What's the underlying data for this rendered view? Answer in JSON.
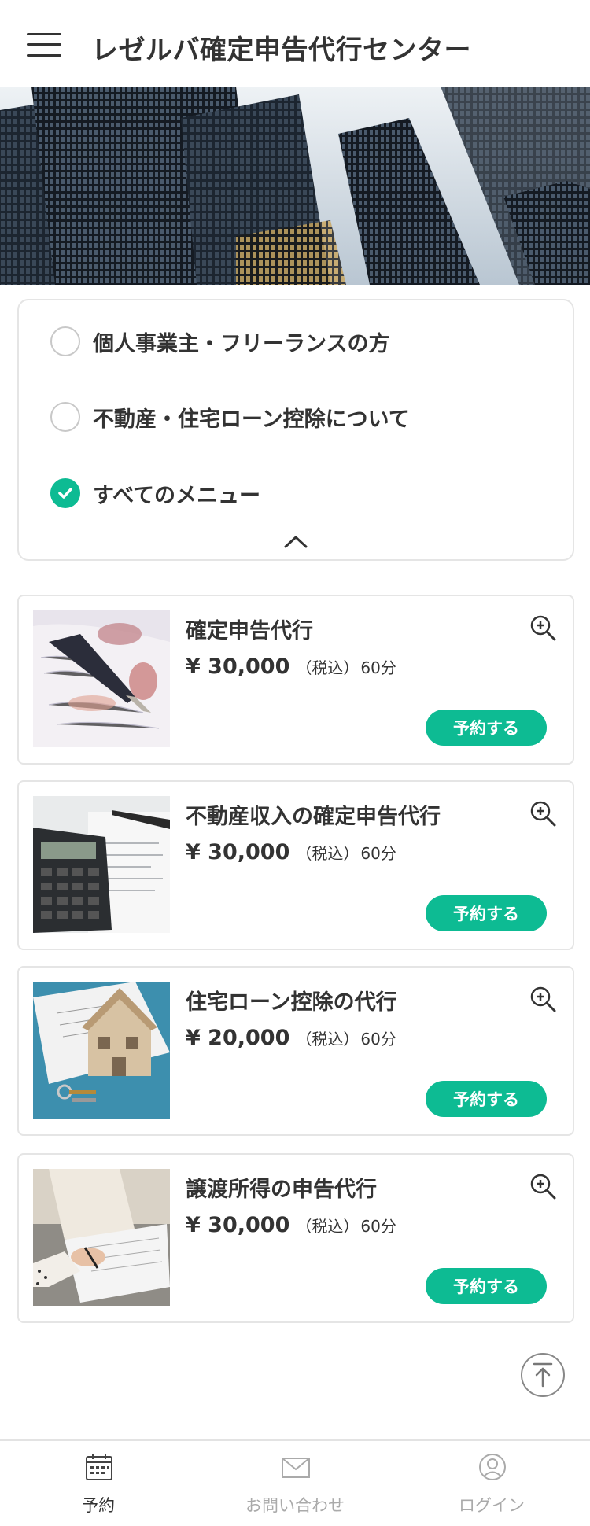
{
  "header": {
    "title": "レゼルバ確定申告代行センター",
    "menu_icon": "hamburger-menu-icon"
  },
  "filters": {
    "options": [
      {
        "label": "個人事業主・フリーランスの方",
        "checked": false
      },
      {
        "label": "不動産・住宅ローン控除について",
        "checked": false
      },
      {
        "label": "すべてのメニュー",
        "checked": true
      }
    ],
    "collapse_icon": "chevron-up-icon"
  },
  "services": [
    {
      "title": "確定申告代行",
      "price": "¥ 30,000",
      "tax": "（税込）",
      "duration": "60分",
      "button": "予約する"
    },
    {
      "title": "不動産収入の確定申告代行",
      "price": "¥ 30,000",
      "tax": "（税込）",
      "duration": "60分",
      "button": "予約する"
    },
    {
      "title": "住宅ローン控除の代行",
      "price": "¥ 20,000",
      "tax": "（税込）",
      "duration": "60分",
      "button": "予約する"
    },
    {
      "title": "譲渡所得の申告代行",
      "price": "¥ 30,000",
      "tax": "（税込）",
      "duration": "60分",
      "button": "予約する"
    }
  ],
  "bottom_nav": {
    "items": [
      {
        "label": "予約",
        "icon": "calendar-icon",
        "active": true
      },
      {
        "label": "お問い合わせ",
        "icon": "mail-icon",
        "active": false
      },
      {
        "label": "ログイン",
        "icon": "user-icon",
        "active": false
      }
    ]
  },
  "colors": {
    "accent": "#0dbb93",
    "text": "#333333",
    "inactive": "#aaaaaa",
    "border": "#e5e5e5"
  }
}
